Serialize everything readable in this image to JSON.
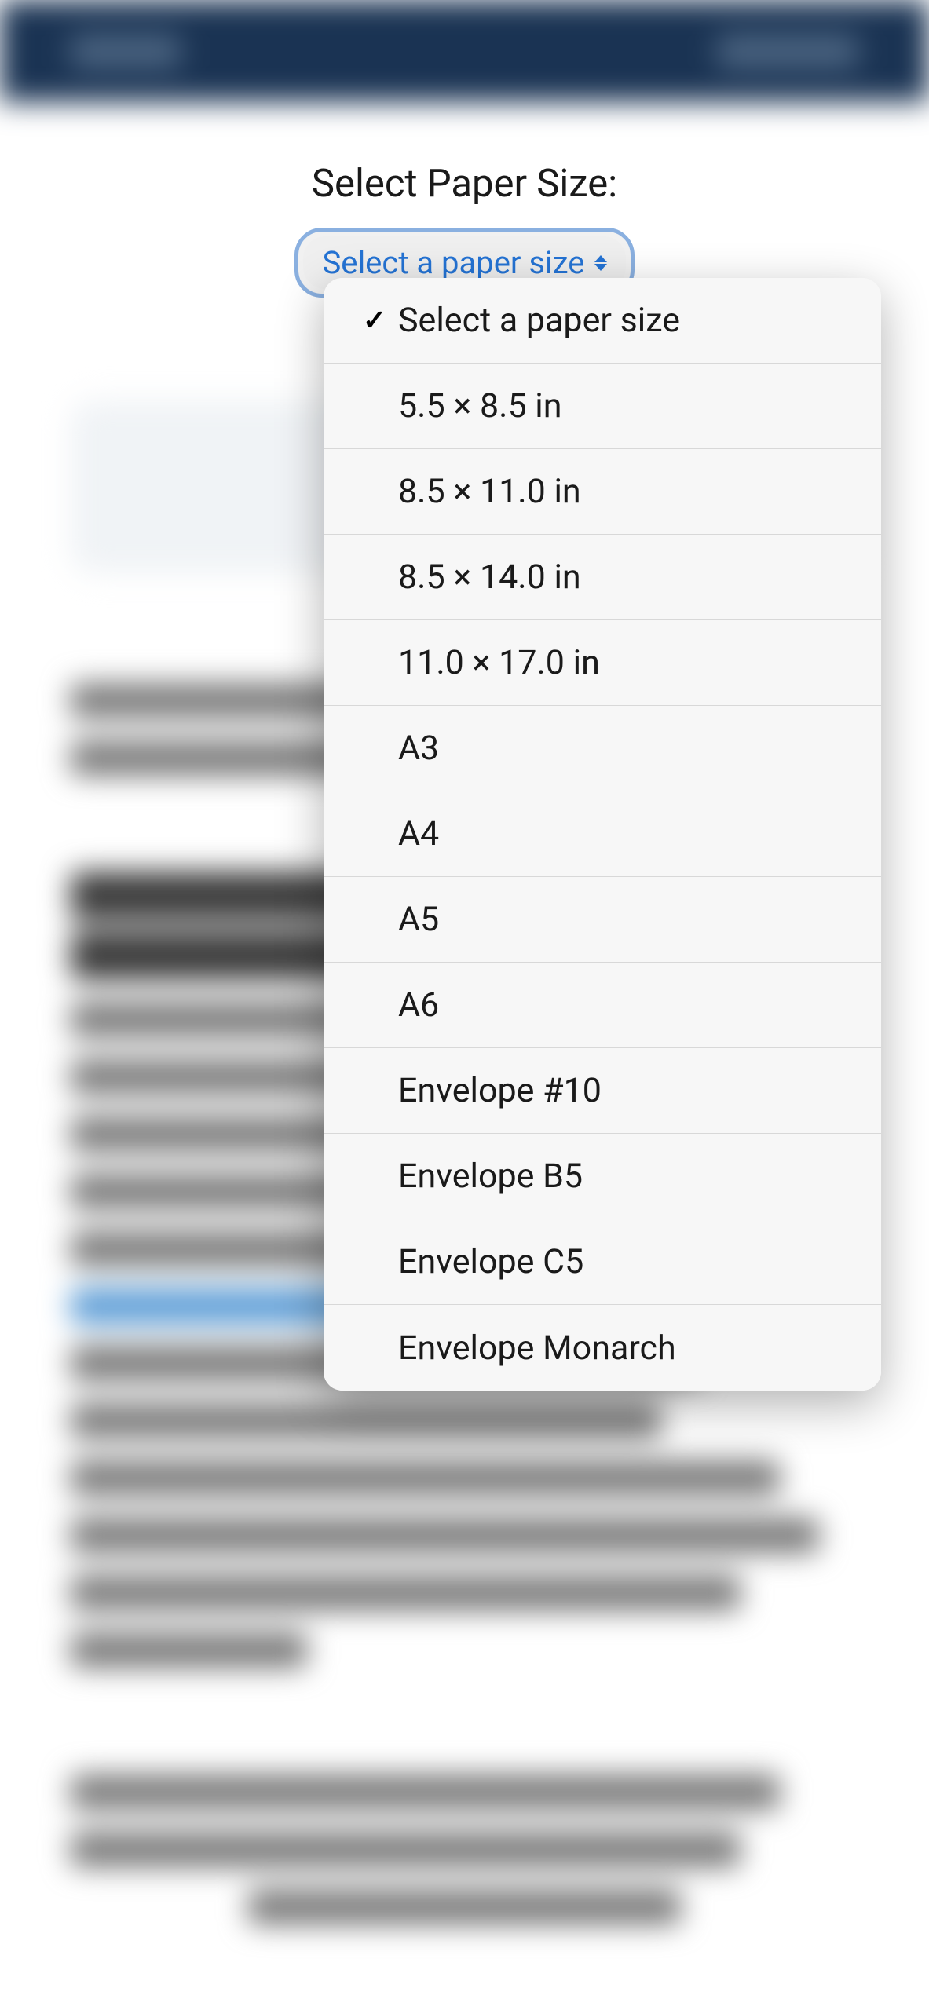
{
  "form": {
    "label": "Select Paper Size:",
    "select_text": "Select a paper size"
  },
  "dropdown": {
    "selected_index": 0,
    "options": [
      "Select a paper size",
      "5.5 × 8.5 in",
      "8.5 × 11.0 in",
      "8.5 × 14.0 in",
      "11.0 × 17.0 in",
      "A3",
      "A4",
      "A5",
      "A6",
      "Envelope #10",
      "Envelope B5",
      "Envelope C5",
      "Envelope Monarch"
    ]
  }
}
